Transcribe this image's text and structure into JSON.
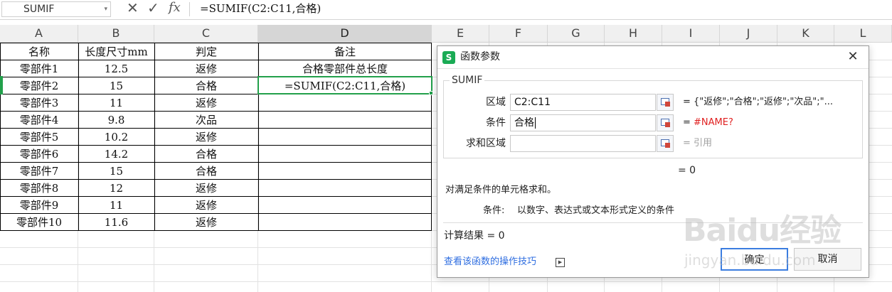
{
  "formula_bar": {
    "name_box": "SUMIF",
    "cancel_icon": "✕",
    "confirm_icon": "✓",
    "fx_icon": "fx",
    "formula": "=SUMIF(C2:C11,合格)"
  },
  "sheet": {
    "columns": [
      "A",
      "B",
      "C",
      "D",
      "E",
      "F",
      "G",
      "H",
      "I",
      "J",
      "K",
      "L"
    ],
    "active_column": "D",
    "header_row": [
      "名称",
      "长度尺寸mm",
      "判定",
      "备注"
    ],
    "rows": [
      [
        "零部件1",
        "12.5",
        "返修",
        "合格零部件总长度"
      ],
      [
        "零部件2",
        "15",
        "合格",
        "=SUMIF(C2:C11,合格)"
      ],
      [
        "零部件3",
        "11",
        "返修",
        ""
      ],
      [
        "零部件4",
        "9.8",
        "次品",
        ""
      ],
      [
        "零部件5",
        "10.2",
        "返修",
        ""
      ],
      [
        "零部件6",
        "14.2",
        "合格",
        ""
      ],
      [
        "零部件7",
        "15",
        "合格",
        ""
      ],
      [
        "零部件8",
        "12",
        "返修",
        ""
      ],
      [
        "零部件9",
        "11",
        "返修",
        ""
      ],
      [
        "零部件10",
        "11.6",
        "返修",
        ""
      ]
    ]
  },
  "dialog": {
    "title": "函数参数",
    "logo": "S",
    "close_icon": "✕",
    "function_name": "SUMIF",
    "args": [
      {
        "label": "区域",
        "value": "C2:C11",
        "result": "= {\"返修\";\"合格\";\"返修\";\"次品\";\"..."
      },
      {
        "label": "条件",
        "value": "合格",
        "result_prefix": "= ",
        "result": "#NAME?"
      },
      {
        "label": "求和区域",
        "value": "",
        "result": "= 引用"
      }
    ],
    "function_result": "= 0",
    "description": "对满足条件的单元格求和。",
    "arg_desc_name": "条件:",
    "arg_desc_text": "以数字、表达式或文本形式定义的条件",
    "calc_result": "计算结果 = 0",
    "help_link": "查看该函数的操作技巧",
    "ok_label": "确定",
    "cancel_label": "取消"
  },
  "watermark": {
    "logo": "Baidu经验",
    "url": "jingyan.baidu.com"
  },
  "colors": {
    "accent_green": "#22a04b",
    "error_red": "#e02020",
    "link_blue": "#2f6ee0"
  }
}
